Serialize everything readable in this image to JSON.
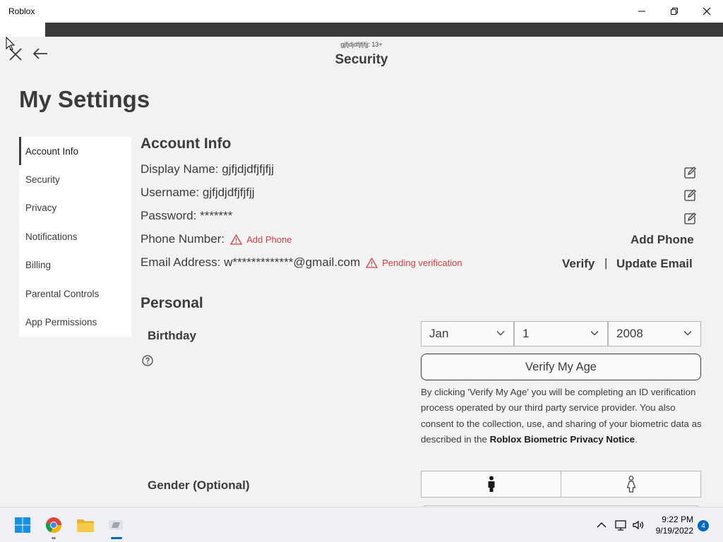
{
  "window": {
    "title": "Roblox"
  },
  "header": {
    "subtitle": "gjfjdjdfjfjfjj: 13+",
    "title": "Security"
  },
  "page_title": "My Settings",
  "sidebar": {
    "items": [
      {
        "label": "Account Info",
        "active": true
      },
      {
        "label": "Security"
      },
      {
        "label": "Privacy"
      },
      {
        "label": "Notifications"
      },
      {
        "label": "Billing"
      },
      {
        "label": "Parental Controls"
      },
      {
        "label": "App Permissions"
      }
    ]
  },
  "account_info": {
    "title": "Account Info",
    "display_name": "Display Name: gjfjdjdfjfjfjj",
    "username": "Username: gjfjdjdfjfjfjj",
    "password": "Password: *******",
    "phone_label": "Phone Number:",
    "phone_warning": "Add Phone",
    "phone_action": "Add Phone",
    "email_label": "Email Address: w*************@gmail.com",
    "email_warning": "Pending verification",
    "email_verify": "Verify",
    "email_separator": "|",
    "email_update": "Update Email"
  },
  "personal": {
    "title": "Personal",
    "birthday_label": "Birthday",
    "birthday_month": "Jan",
    "birthday_day": "1",
    "birthday_year": "2008",
    "verify_button": "Verify My Age",
    "disclaimer_text": "By clicking 'Verify My Age' you will be completing an ID verification process operated by our third party service provider. You also consent to the collection, use, and sharing of your biometric data as described in the ",
    "disclaimer_link": "Roblox Biometric Privacy Notice",
    "disclaimer_end": ".",
    "gender_label": "Gender (Optional)"
  },
  "taskbar": {
    "clock_time": "9:22 PM",
    "clock_date": "9/19/2022",
    "notification_count": "4"
  },
  "colors": {
    "warning": "#d63f3f",
    "text": "#393b3d",
    "accent": "#0067c0"
  }
}
